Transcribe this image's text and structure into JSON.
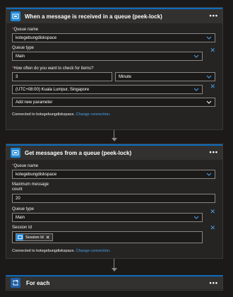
{
  "step1": {
    "title": "When a message is received in a queue (peek-lock)",
    "queue_name_label": "Queue name",
    "queue_name_value": "kotegebungdiskspace",
    "queue_type_label": "Queue type",
    "queue_type_value": "Main",
    "interval_label": "How often do you want to check for items?",
    "interval_value": "3",
    "frequency_value": "Minute",
    "timezone_value": "(UTC+08:00) Kuala Lumpur, Singapore",
    "add_param_label": "Add new parameter",
    "connected_text": "Connected to kotegebungdiskspace.",
    "change_connection": "Change connection."
  },
  "step2": {
    "title": "Get messages from a queue (peek-lock)",
    "queue_name_label": "Queue name",
    "queue_name_value": "kotegebungdiskspace",
    "max_count_label_1": "Maximum message",
    "max_count_label_2": "count",
    "max_count_value": "20",
    "queue_type_label": "Queue type",
    "queue_type_value": "Main",
    "session_label": "Session Id",
    "session_token": "Session Id",
    "connected_text": "Connected to kotegebungdiskspace.",
    "change_connection": "Change connection."
  },
  "step3": {
    "title": "For each"
  },
  "icons": {
    "service_bus": "service-bus-icon",
    "foreach": "loop-icon",
    "more": "more-icon",
    "close": "close-icon",
    "chevron": "chevron-down-icon"
  },
  "colors": {
    "accent": "#0f6cbd",
    "link": "#4aa3f0",
    "background": "#1b1a19",
    "card": "#252423"
  }
}
